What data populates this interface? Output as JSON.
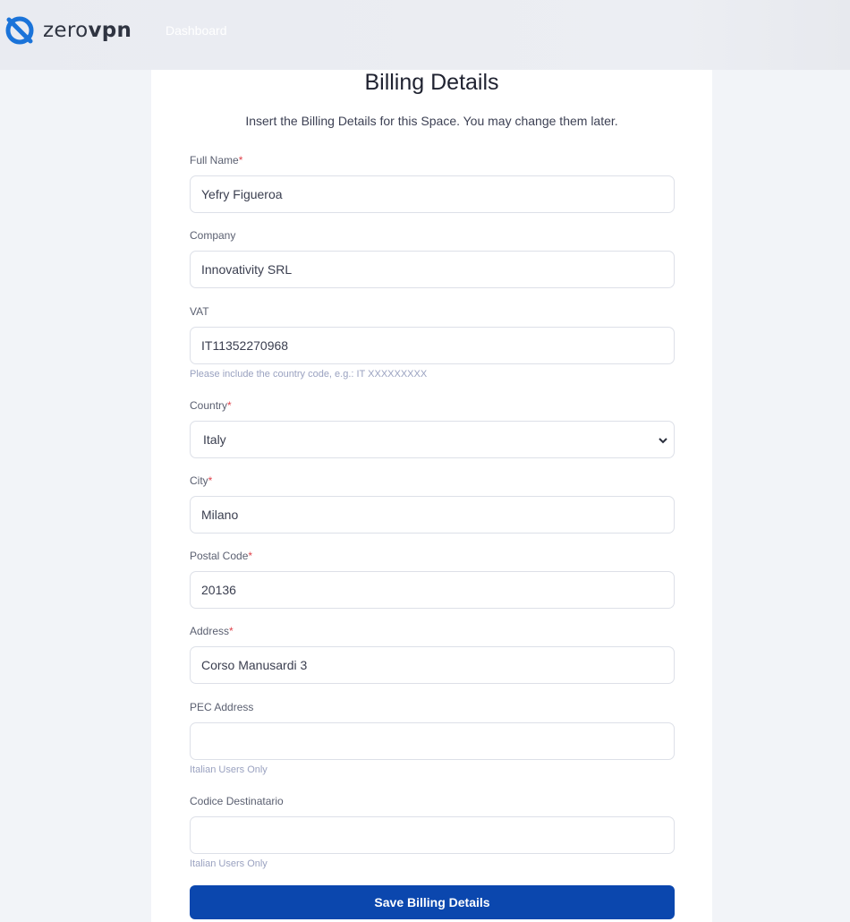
{
  "header": {
    "brand_light": "zero",
    "brand_bold": "vpn",
    "nav_dashboard": "Dashboard"
  },
  "form": {
    "title": "Billing Details",
    "subtitle": "Insert the Billing Details for this Space. You may change them later.",
    "required_mark": "*",
    "full_name": {
      "label": "Full Name",
      "value": "Yefry Figueroa"
    },
    "company": {
      "label": "Company",
      "value": "Innovativity SRL"
    },
    "vat": {
      "label": "VAT",
      "value": "IT11352270968",
      "help": "Please include the country code, e.g.: IT XXXXXXXXX"
    },
    "country": {
      "label": "Country",
      "value": "Italy"
    },
    "city": {
      "label": "City",
      "value": "Milano"
    },
    "postal_code": {
      "label": "Postal Code",
      "value": "20136"
    },
    "address": {
      "label": "Address",
      "value": "Corso Manusardi 3"
    },
    "pec": {
      "label": "PEC Address",
      "value": "",
      "help": "Italian Users Only"
    },
    "codice": {
      "label": "Codice Destinatario",
      "value": "",
      "help": "Italian Users Only"
    },
    "save_label": "Save Billing Details"
  },
  "colors": {
    "primary": "#0b47ae",
    "logo_blue": "#1a73d9",
    "required": "#e0424b"
  }
}
